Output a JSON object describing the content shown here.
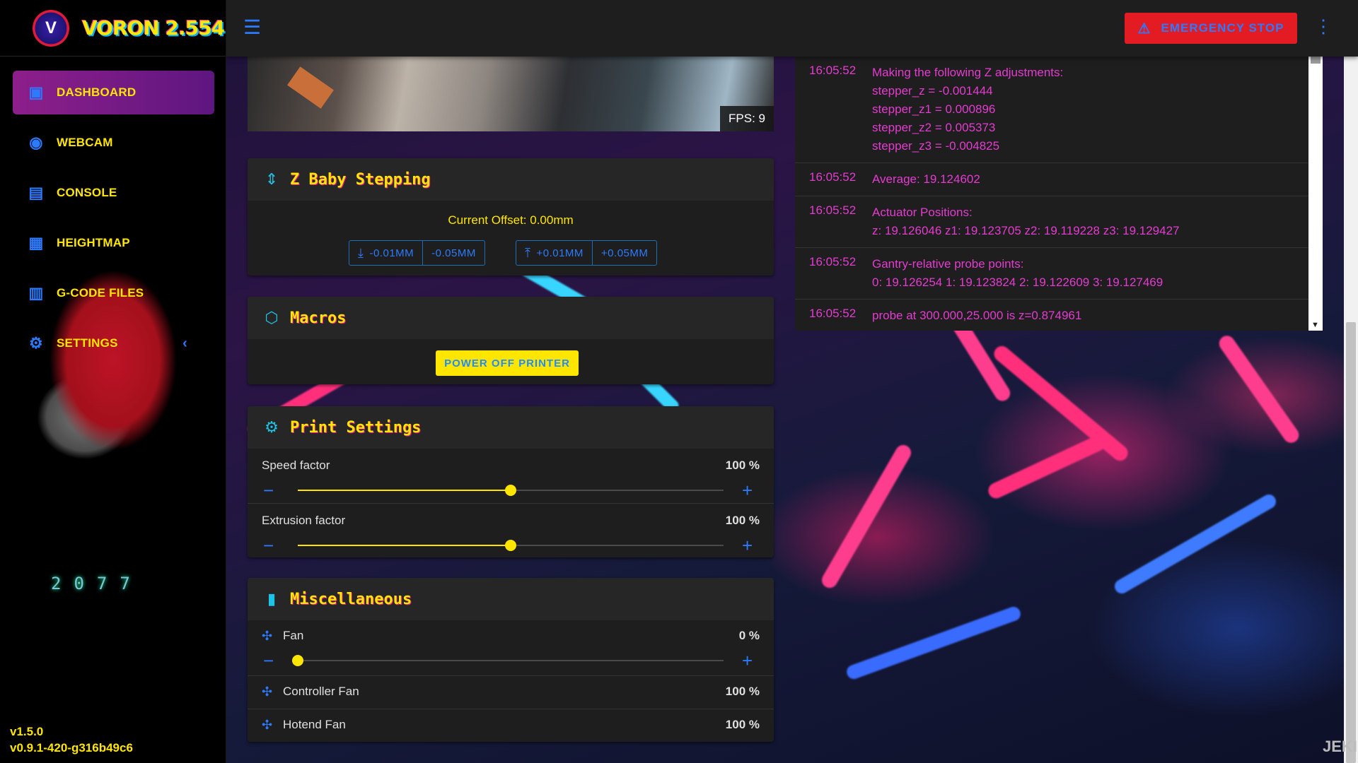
{
  "brand": {
    "logo_text": "V",
    "title": "VORON 2.554"
  },
  "sidebar": {
    "items": [
      {
        "label": "DASHBOARD",
        "icon": "monitor-icon",
        "active": true
      },
      {
        "label": "WEBCAM",
        "icon": "eye-icon"
      },
      {
        "label": "CONSOLE",
        "icon": "console-icon"
      },
      {
        "label": "HEIGHTMAP",
        "icon": "grid-icon"
      },
      {
        "label": "G-CODE FILES",
        "icon": "file-code-icon"
      },
      {
        "label": "SETTINGS",
        "icon": "gear-icon"
      }
    ],
    "year": "2077",
    "version_client": "v1.5.0",
    "version_server": "v0.9.1-420-g316b49c6"
  },
  "topbar": {
    "emergency_stop": "EMERGENCY STOP"
  },
  "webcam": {
    "fps": "FPS: 9"
  },
  "z_baby_stepping": {
    "title": "Z Baby Stepping",
    "current_offset": "Current Offset: 0.00mm",
    "down_small": "-0.01MM",
    "down_large": "-0.05MM",
    "up_small": "+0.01MM",
    "up_large": "+0.05MM"
  },
  "macros": {
    "title": "Macros",
    "power_off": "POWER OFF PRINTER"
  },
  "print_settings": {
    "title": "Print Settings",
    "speed": {
      "label": "Speed factor",
      "value": "100 %",
      "level": 0.5
    },
    "extrusion": {
      "label": "Extrusion factor",
      "value": "100 %",
      "level": 0.5
    }
  },
  "misc": {
    "title": "Miscellaneous",
    "fan": {
      "label": "Fan",
      "value": "0 %",
      "level": 0
    },
    "controller_fan": {
      "label": "Controller Fan",
      "value": "100 %"
    },
    "hotend_fan": {
      "label": "Hotend Fan",
      "value": "100 %"
    }
  },
  "console": {
    "entries": [
      {
        "time": "16:05:52",
        "msg": "Making the following Z adjustments:\nstepper_z = -0.001444\nstepper_z1 = 0.000896\nstepper_z2 = 0.005373\nstepper_z3 = -0.004825"
      },
      {
        "time": "16:05:52",
        "msg": "Average: 19.124602"
      },
      {
        "time": "16:05:52",
        "msg": "Actuator Positions:\nz: 19.126046 z1: 19.123705 z2: 19.119228 z3: 19.129427"
      },
      {
        "time": "16:05:52",
        "msg": "Gantry-relative probe points:\n0: 19.126254 1: 19.123824 2: 19.122609 3: 19.127469"
      },
      {
        "time": "16:05:52",
        "msg": "probe at 300.000,25.000 is z=0.874961"
      }
    ]
  },
  "watermark": "JEKI",
  "colors": {
    "accent_yellow": "#ffe600",
    "accent_blue": "#2c7bff",
    "console_magenta": "#e43cd0",
    "estop_red": "#e31b23"
  }
}
